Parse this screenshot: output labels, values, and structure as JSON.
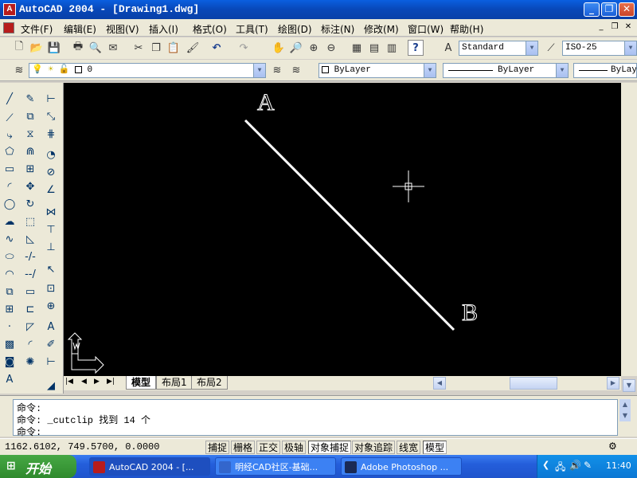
{
  "window": {
    "title": "AutoCAD 2004 - [Drawing1.dwg]",
    "app_icon": "A",
    "buttons": [
      "_",
      "❐",
      "✕"
    ]
  },
  "menubar": {
    "items": [
      "文件(F)",
      "编辑(E)",
      "视图(V)",
      "插入(I)",
      "格式(O)",
      "工具(T)",
      "绘图(D)",
      "标注(N)",
      "修改(M)",
      "窗口(W)",
      "帮助(H)"
    ],
    "mdi_buttons": [
      "_",
      "❐",
      "✕"
    ]
  },
  "standard_toolbar": {
    "text_style": "Standard",
    "dim_style": "ISO-25"
  },
  "layers_toolbar": {
    "current_layer": "0",
    "color": "ByLayer",
    "linetype": "ByLayer",
    "lineweight": "ByLayer"
  },
  "drawing": {
    "labels": [
      "A",
      "B"
    ],
    "background": "#000000",
    "line_color": "#ffffff"
  },
  "layout_tabs": [
    "模型",
    "布局1",
    "布局2"
  ],
  "command": {
    "lines": [
      "命令:",
      "命令: _cutclip 找到 14 个",
      "命令:"
    ]
  },
  "status": {
    "coordinates": "1162.6102, 749.5700, 0.0000",
    "toggles": [
      {
        "label": "捕捉",
        "on": false
      },
      {
        "label": "栅格",
        "on": false
      },
      {
        "label": "正交",
        "on": false
      },
      {
        "label": "极轴",
        "on": false
      },
      {
        "label": "对象捕捉",
        "on": true
      },
      {
        "label": "对象追踪",
        "on": false
      },
      {
        "label": "线宽",
        "on": false
      },
      {
        "label": "模型",
        "on": true
      }
    ]
  },
  "taskbar": {
    "start_label": "开始",
    "tasks": [
      {
        "label": "AutoCAD 2004 - [...",
        "icon_color": "#b71c1c",
        "active": true
      },
      {
        "label": "明经CAD社区-基础...",
        "icon_color": "#3366cc",
        "active": false
      },
      {
        "label": "Adobe Photoshop ...",
        "icon_color": "#1a2a55",
        "active": false
      }
    ],
    "clock": "11:40"
  }
}
